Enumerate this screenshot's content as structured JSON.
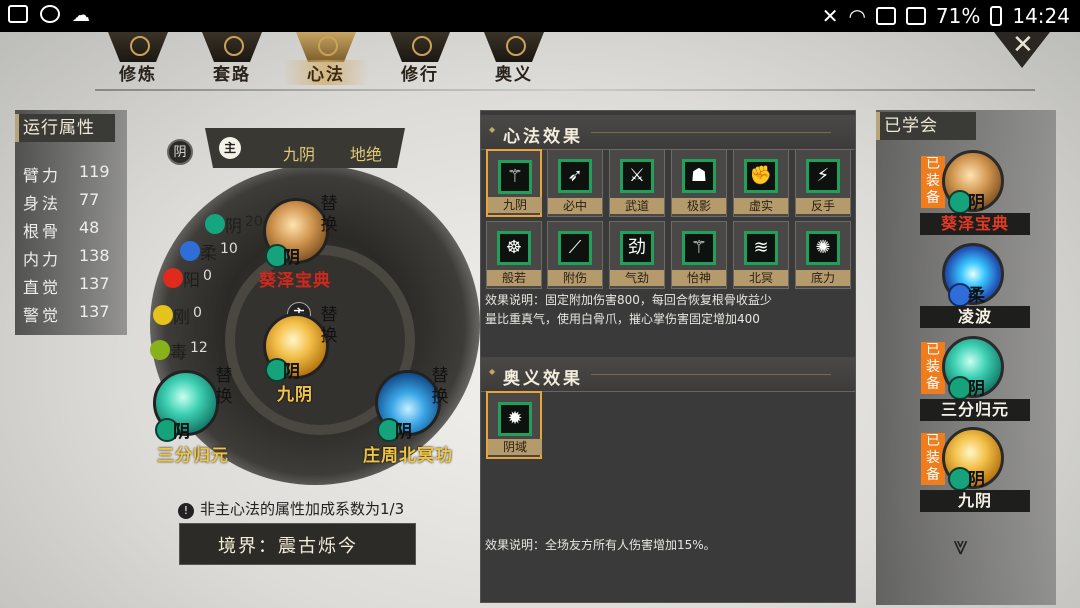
{
  "status_bar": {
    "battery": "71%",
    "time": "14:24"
  },
  "tabs": [
    {
      "label": "修炼",
      "active": false
    },
    {
      "label": "套路",
      "active": false
    },
    {
      "label": "心法",
      "active": true
    },
    {
      "label": "修行",
      "active": false
    },
    {
      "label": "奥义",
      "active": false
    }
  ],
  "attributes": {
    "title": "运行属性",
    "rows": [
      {
        "name": "臂力",
        "value": "119"
      },
      {
        "name": "身法",
        "value": "77"
      },
      {
        "name": "根骨",
        "value": "48"
      },
      {
        "name": "内力",
        "value": "138"
      },
      {
        "name": "直觉",
        "value": "137"
      },
      {
        "name": "警觉",
        "value": "137"
      }
    ]
  },
  "center": {
    "yin_label": "阴",
    "main_label": "主",
    "main_skill": "九阴",
    "realm_tier": "地绝",
    "elements": [
      {
        "name": "阴",
        "value": "204",
        "color": "#15a57f"
      },
      {
        "name": "柔",
        "value": "10",
        "color": "#2f6ed8"
      },
      {
        "name": "阳",
        "value": "0",
        "color": "#e02a1c"
      },
      {
        "name": "刚",
        "value": "0",
        "color": "#e6c21c"
      },
      {
        "name": "毒",
        "value": "12",
        "color": "#86b21c"
      }
    ],
    "slots": {
      "top": {
        "name": "葵泽宝典",
        "tag": "阴",
        "swap": "替换"
      },
      "middle": {
        "name": "九阴",
        "tag": "阴",
        "swap": "替换",
        "main": "主"
      },
      "left": {
        "name": "三分归元",
        "tag": "阴",
        "swap": "替换"
      },
      "right": {
        "name": "庄周北冥功",
        "tag": "阴",
        "swap": "替换"
      }
    },
    "note": "非主心法的属性加成系数为1/3",
    "realm": "境界：震古烁今"
  },
  "effects": {
    "xinfa_title": "心法效果",
    "xinfa_cells": [
      {
        "label": "九阴",
        "icon": "trident-icon",
        "glyph": "⚚"
      },
      {
        "label": "必中",
        "icon": "bow-icon",
        "glyph": "➶"
      },
      {
        "label": "武道",
        "icon": "sword-icon",
        "glyph": "⚔"
      },
      {
        "label": "极影",
        "icon": "shadow-icon",
        "glyph": "☗"
      },
      {
        "label": "虚实",
        "icon": "fist-icon",
        "glyph": "✊"
      },
      {
        "label": "反手",
        "icon": "runner-icon",
        "glyph": "⚡"
      },
      {
        "label": "般若",
        "icon": "monk-icon",
        "glyph": "☸"
      },
      {
        "label": "附伤",
        "icon": "blade-icon",
        "glyph": "⟋"
      },
      {
        "label": "气劲",
        "icon": "qi-icon",
        "glyph": "劲"
      },
      {
        "label": "怡神",
        "icon": "spirit-icon",
        "glyph": "⚚"
      },
      {
        "label": "北冥",
        "icon": "wave-icon",
        "glyph": "≋"
      },
      {
        "label": "底力",
        "icon": "spiral-icon",
        "glyph": "✺"
      }
    ],
    "xinfa_desc_line1": "效果说明：固定附加伤害800，每回合恢复根骨收益少",
    "xinfa_desc_line2": "量比重真气，使用白骨爪，摧心掌伤害固定增加400",
    "aoyi_title": "奥义效果",
    "aoyi_cells": [
      {
        "label": "阴域",
        "icon": "yin-domain-icon",
        "glyph": "✹"
      }
    ],
    "aoyi_desc": "效果说明：全场友方所有人伤害增加15%。"
  },
  "learned": {
    "title": "已学会",
    "items": [
      {
        "name": "葵泽宝典",
        "equip": "已装备",
        "tag": "阴",
        "name_color": "red"
      },
      {
        "name": "凌波",
        "equip": "",
        "tag": "柔",
        "name_color": "white"
      },
      {
        "name": "三分归元",
        "equip": "已装备",
        "tag": "阴",
        "name_color": "white"
      },
      {
        "name": "九阴",
        "equip": "已装备",
        "tag": "阴",
        "name_color": "white"
      }
    ]
  },
  "colors": {
    "accent_gold": "#c7a463",
    "equip_orange": "#f07d1d",
    "selection": "#e8a63a",
    "icon_green": "#20a05a"
  }
}
